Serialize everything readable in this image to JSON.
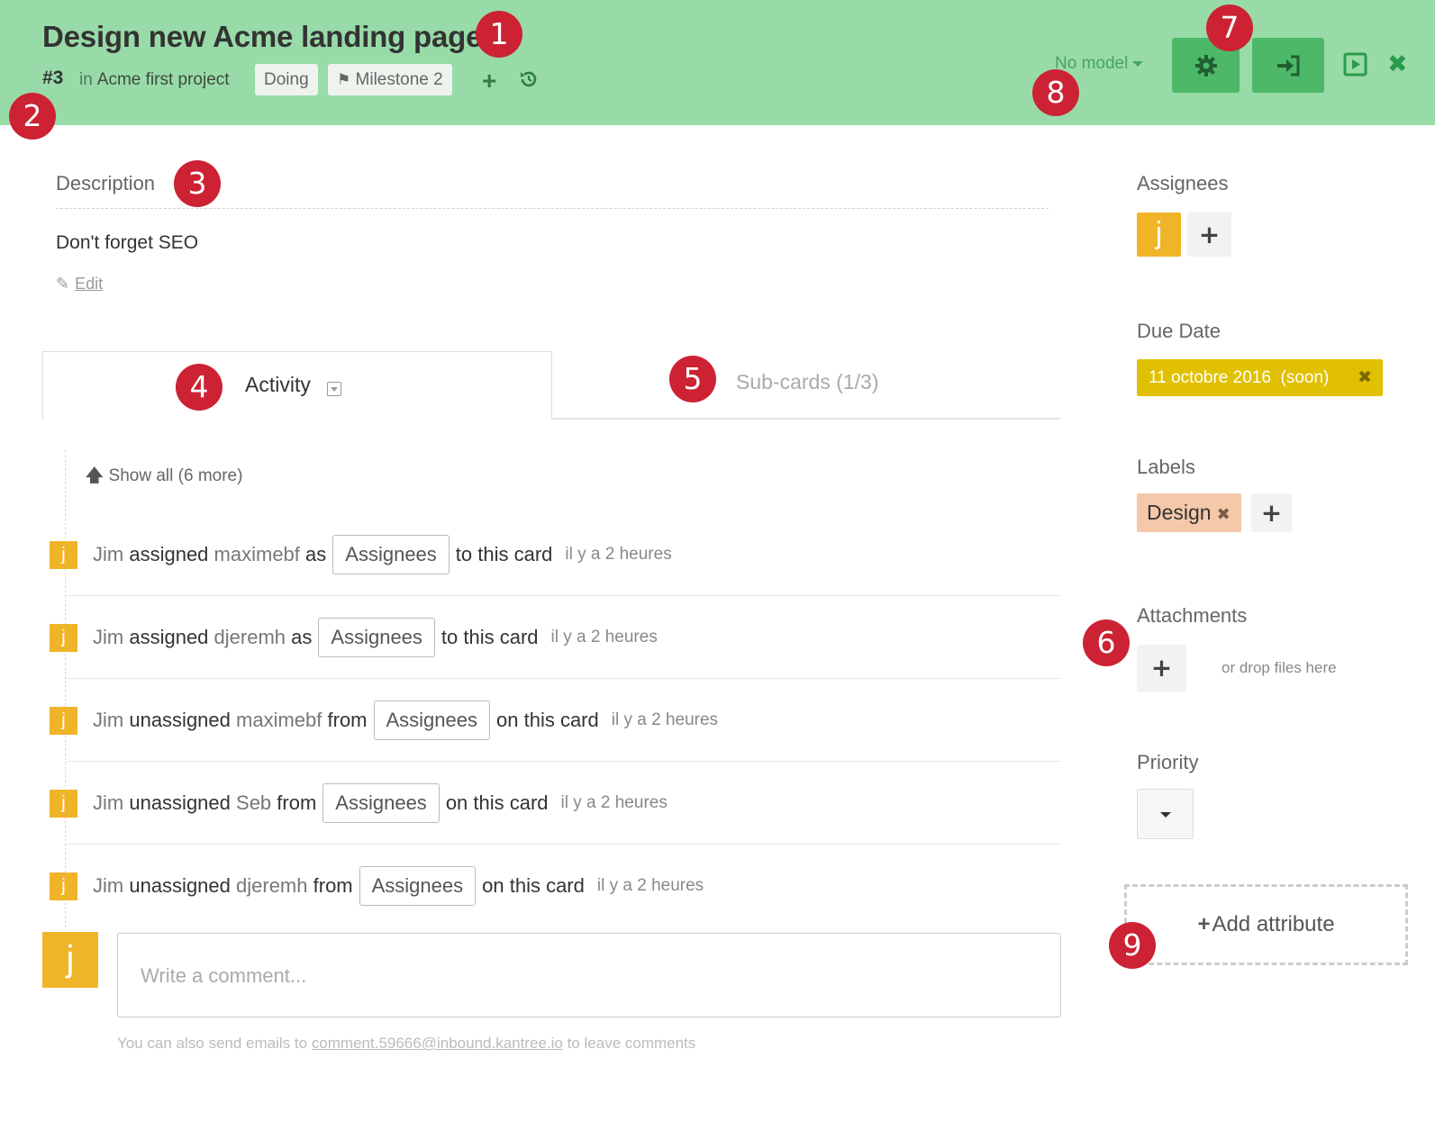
{
  "header": {
    "title": "Design new Acme landing page",
    "card_number": "#3",
    "in_label": "in",
    "project": "Acme first project",
    "status": "Doing",
    "milestone": "Milestone 2",
    "model_label": "No model",
    "icons": [
      "plus-icon",
      "history-icon",
      "flag-icon",
      "gear-icon",
      "sign-in-icon",
      "present-icon",
      "close-icon"
    ],
    "bg_color": "#98dba8",
    "button_color": "#4cb868"
  },
  "badges": [
    "1",
    "2",
    "3",
    "4",
    "5",
    "6",
    "7",
    "8",
    "9"
  ],
  "description": {
    "label": "Description",
    "text": "Don't forget SEO",
    "edit_label": "Edit"
  },
  "tabs": {
    "activity": "Activity",
    "subcards": "Sub-cards (1/3)"
  },
  "activity": {
    "show_all": "Show all (6 more)",
    "items": [
      {
        "avatar": "j",
        "actor": "Jim",
        "verb": "assigned",
        "target": "maximebf",
        "prep": "as",
        "chip": "Assignees",
        "tail": "to this card",
        "time": "il y a 2 heures"
      },
      {
        "avatar": "j",
        "actor": "Jim",
        "verb": "assigned",
        "target": "djeremh",
        "prep": "as",
        "chip": "Assignees",
        "tail": "to this card",
        "time": "il y a 2 heures"
      },
      {
        "avatar": "j",
        "actor": "Jim",
        "verb": "unassigned",
        "target": "maximebf",
        "prep": "from",
        "chip": "Assignees",
        "tail": "on this card",
        "time": "il y a 2 heures"
      },
      {
        "avatar": "j",
        "actor": "Jim",
        "verb": "unassigned",
        "target": "Seb",
        "prep": "from",
        "chip": "Assignees",
        "tail": "on this card",
        "time": "il y a 2 heures"
      },
      {
        "avatar": "j",
        "actor": "Jim",
        "verb": "unassigned",
        "target": "djeremh",
        "prep": "from",
        "chip": "Assignees",
        "tail": "on this card",
        "time": "il y a 2 heures"
      }
    ]
  },
  "comment": {
    "avatar": "j",
    "placeholder": "Write a comment...",
    "note_before": "You can also send emails to",
    "email": "comment.59666@inbound.kantree.io",
    "note_after": "to leave comments"
  },
  "sidebar": {
    "assignees_label": "Assignees",
    "assignee_avatar": "j",
    "due_label": "Due Date",
    "due_value": "11 octobre 2016",
    "due_soon": "(soon)",
    "due_color": "#e0c000",
    "labels_label": "Labels",
    "label_design": "Design",
    "label_design_color": "#f4c8a8",
    "attachments_label": "Attachments",
    "drop_text": "or drop files here",
    "priority_label": "Priority",
    "add_attribute": "Add attribute"
  }
}
